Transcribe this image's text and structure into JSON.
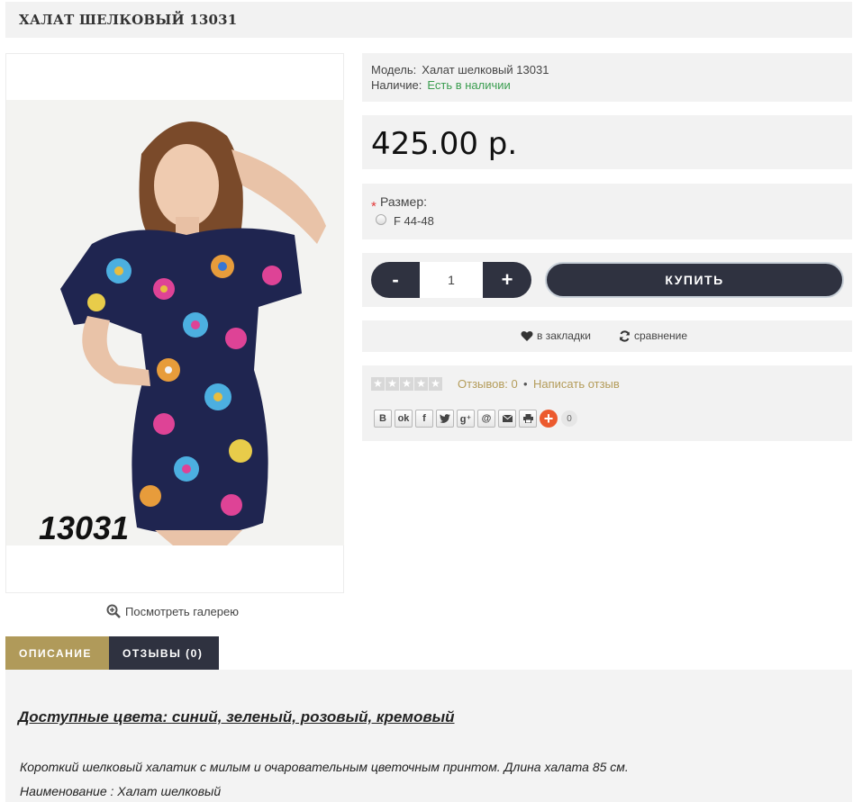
{
  "product": {
    "title": "ХАЛАТ ШЕЛКОВЫЙ 13031",
    "image_code": "13031",
    "gallery_link": "Посмотреть галерею"
  },
  "info": {
    "model_label": "Модель:",
    "model_value": "Халат шелковый 13031",
    "stock_label": "Наличие:",
    "stock_value": "Есть в наличии"
  },
  "price": "425.00 р.",
  "options": {
    "required_mark": "*",
    "size_label": "Размер:",
    "size_options": [
      "F 44-48"
    ]
  },
  "buy": {
    "minus": "-",
    "plus": "+",
    "quantity": "1",
    "buy_label": "КУПИТЬ"
  },
  "actions": {
    "wishlist": "в закладки",
    "compare": "сравнение"
  },
  "reviews": {
    "count_link": "Отзывов: 0",
    "separator": "•",
    "write_link": "Написать отзыв",
    "stars_filled": 0,
    "stars_total": 5
  },
  "share": {
    "buttons": [
      "vk-icon",
      "odnoklassniki-icon",
      "facebook-icon",
      "twitter-icon",
      "google-plus-icon",
      "mailru-icon",
      "email-icon",
      "print-icon"
    ],
    "count": "0"
  },
  "tabs": [
    {
      "label": "ОПИСАНИЕ",
      "active": true
    },
    {
      "label": "ОТЗЫВЫ (0)",
      "active": false
    }
  ],
  "description": {
    "heading": "Доступные цвета: синий, зеленый, розовый, кремовый",
    "paragraph": "Короткий шелковый халатик с милым и очаровательным цветочным принтом. Длина халата 85 см.",
    "name_line": "Наименование : Халат шелковый"
  },
  "colors": {
    "dark_button": "#2f3240",
    "gold_accent": "#b09a5a",
    "in_stock_green": "#3a9d4f",
    "panel_bg": "#f2f2f2"
  }
}
